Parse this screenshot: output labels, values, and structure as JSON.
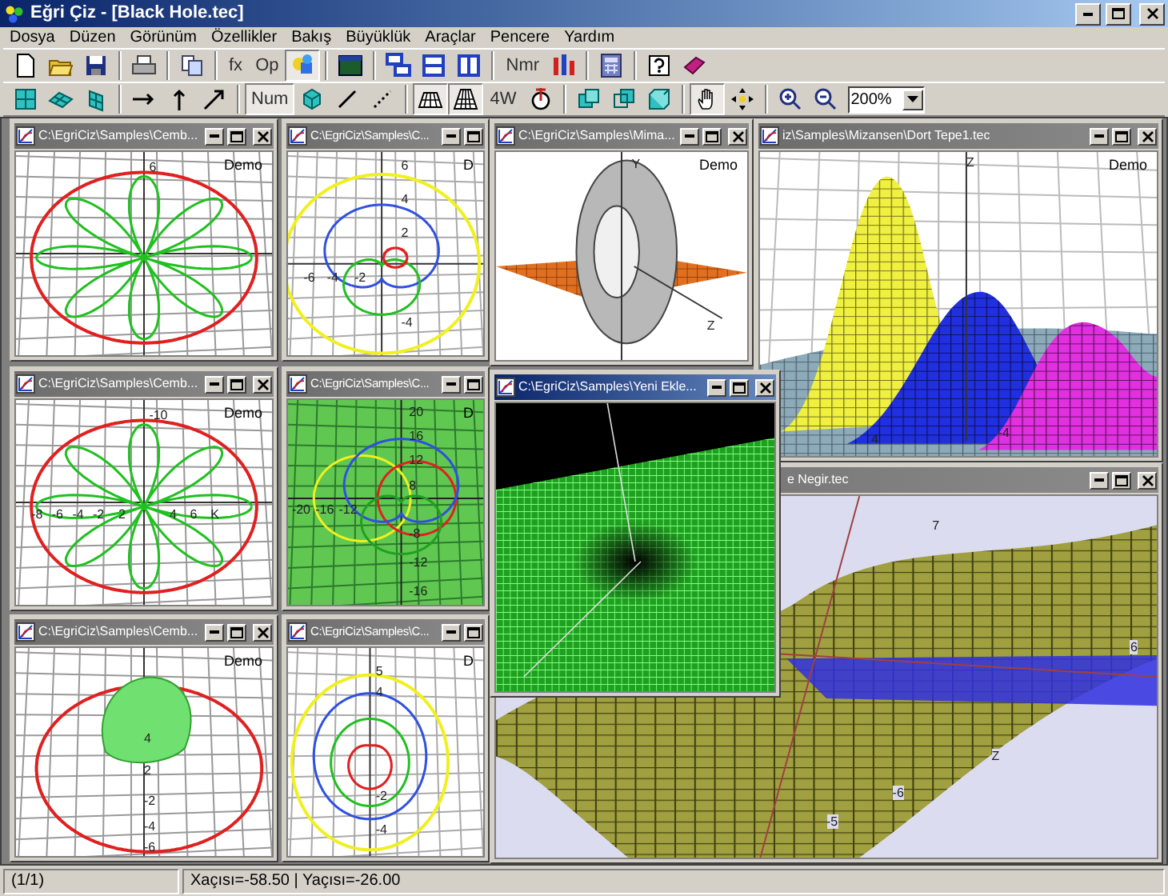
{
  "window": {
    "title": "Eğri Çiz - [Black Hole.tec]"
  },
  "menu": [
    "Dosya",
    "Düzen",
    "Görünüm",
    "Özellikler",
    "Bakış",
    "Büyüklük",
    "Araçlar",
    "Pencere",
    "Yardım"
  ],
  "toolbar_1": [
    {
      "kind": "page",
      "pressed": false
    },
    {
      "kind": "folder",
      "pressed": false
    },
    {
      "kind": "disk",
      "pressed": false
    },
    {
      "kind": "separator"
    },
    {
      "kind": "printer",
      "pressed": false
    },
    {
      "kind": "separator"
    },
    {
      "kind": "copy",
      "pressed": false
    },
    {
      "kind": "separator"
    },
    {
      "kind": "text",
      "label": "fx",
      "pressed": false
    },
    {
      "kind": "text",
      "label": "Op",
      "pressed": false
    },
    {
      "kind": "shapes",
      "pressed": true
    },
    {
      "kind": "separator"
    },
    {
      "kind": "screen",
      "pressed": false
    },
    {
      "kind": "separator"
    },
    {
      "kind": "stack",
      "pressed": false
    },
    {
      "kind": "rows",
      "pressed": false
    },
    {
      "kind": "columns",
      "pressed": false
    },
    {
      "kind": "separator"
    },
    {
      "kind": "text",
      "label": "Nmr",
      "pressed": false
    },
    {
      "kind": "tools",
      "pressed": false
    },
    {
      "kind": "separator"
    },
    {
      "kind": "calculator",
      "pressed": false
    },
    {
      "kind": "separator"
    },
    {
      "kind": "help",
      "pressed": false
    },
    {
      "kind": "book",
      "pressed": false
    }
  ],
  "toolbar_2": [
    {
      "kind": "grid",
      "pressed": false
    },
    {
      "kind": "plane",
      "pressed": false
    },
    {
      "kind": "plane-side",
      "pressed": false
    },
    {
      "kind": "separator"
    },
    {
      "kind": "axis-x",
      "pressed": false
    },
    {
      "kind": "axis-y",
      "pressed": false
    },
    {
      "kind": "axis-z",
      "pressed": false
    },
    {
      "kind": "separator"
    },
    {
      "kind": "text",
      "label": "Num",
      "pressed": true
    },
    {
      "kind": "cube",
      "pressed": false
    },
    {
      "kind": "line",
      "pressed": false
    },
    {
      "kind": "dotted-line",
      "pressed": false
    },
    {
      "kind": "separator"
    },
    {
      "kind": "mesh-flat",
      "pressed": true
    },
    {
      "kind": "mesh",
      "pressed": true
    },
    {
      "kind": "text",
      "label": "4W",
      "pressed": false
    },
    {
      "kind": "tripod",
      "pressed": false
    },
    {
      "kind": "separator"
    },
    {
      "kind": "cube-front",
      "pressed": false
    },
    {
      "kind": "cube-back",
      "pressed": false
    },
    {
      "kind": "cube-solid",
      "pressed": false
    },
    {
      "kind": "separator"
    },
    {
      "kind": "hand",
      "pressed": true
    },
    {
      "kind": "move",
      "pressed": false
    },
    {
      "kind": "separator"
    },
    {
      "kind": "zoom-in",
      "pressed": false
    },
    {
      "kind": "zoom-out",
      "pressed": false
    },
    {
      "kind": "zoom-select",
      "value": "200%"
    }
  ],
  "documents": [
    {
      "title": "C:\\EgriCiz\\Samples\\Cemb...",
      "active": false,
      "kind": "rose",
      "badge": "Demo",
      "labels": [
        "6"
      ]
    },
    {
      "title": "C:\\EgriCiz\\Samples\\C...",
      "active": false,
      "kind": "cardioid",
      "badge": "D",
      "labels": [
        "6",
        "4",
        "2",
        "-6",
        "-4",
        "-2",
        "-4"
      ]
    },
    {
      "title": "C:\\EgriCiz\\Samples\\Mima...",
      "active": false,
      "kind": "torus",
      "badge": "Demo",
      "labels": [
        "Y",
        "Z"
      ]
    },
    {
      "title": "iz\\Samples\\Mizansen\\Dort Tepe1.tec",
      "active": false,
      "kind": "peaks",
      "badge": "Demo",
      "labels": [
        "Z",
        "4",
        "-4"
      ]
    },
    {
      "title": "C:\\EgriCiz\\Samples\\Cemb...",
      "active": false,
      "kind": "rose",
      "badge": "Demo",
      "labels": [
        "-10",
        "-8",
        "-6",
        "-4",
        "-2",
        "2",
        "4",
        "6",
        "K"
      ]
    },
    {
      "title": "C:\\EgriCiz\\Samples\\C...",
      "active": false,
      "kind": "green-polar",
      "badge": "D",
      "labels": [
        "20",
        "16",
        "12",
        "8",
        "-20",
        "-16",
        "-12",
        "-8",
        "-12",
        "-16"
      ]
    },
    {
      "title": "C:\\EgriCiz\\Samples\\Yeni Ekle...",
      "active": true,
      "kind": "hole"
    },
    {
      "title": "e Negir.tec",
      "active": false,
      "kind": "surface",
      "labels": [
        "7",
        "6",
        "-5",
        "-6",
        "Z"
      ]
    },
    {
      "title": "C:\\EgriCiz\\Samples\\Cemb...",
      "active": false,
      "kind": "blob",
      "badge": "Demo",
      "labels": [
        "4",
        "2",
        "-2",
        "-4",
        "-6"
      ]
    },
    {
      "title": "C:\\EgriCiz\\Samples\\C...",
      "active": false,
      "kind": "circles",
      "badge": "D",
      "labels": [
        "5",
        "4",
        "-2",
        "-4"
      ]
    }
  ],
  "status_bar": [
    "(1/1)",
    "Xaçısı=-58.50 | Yaçısı=-26.00"
  ]
}
